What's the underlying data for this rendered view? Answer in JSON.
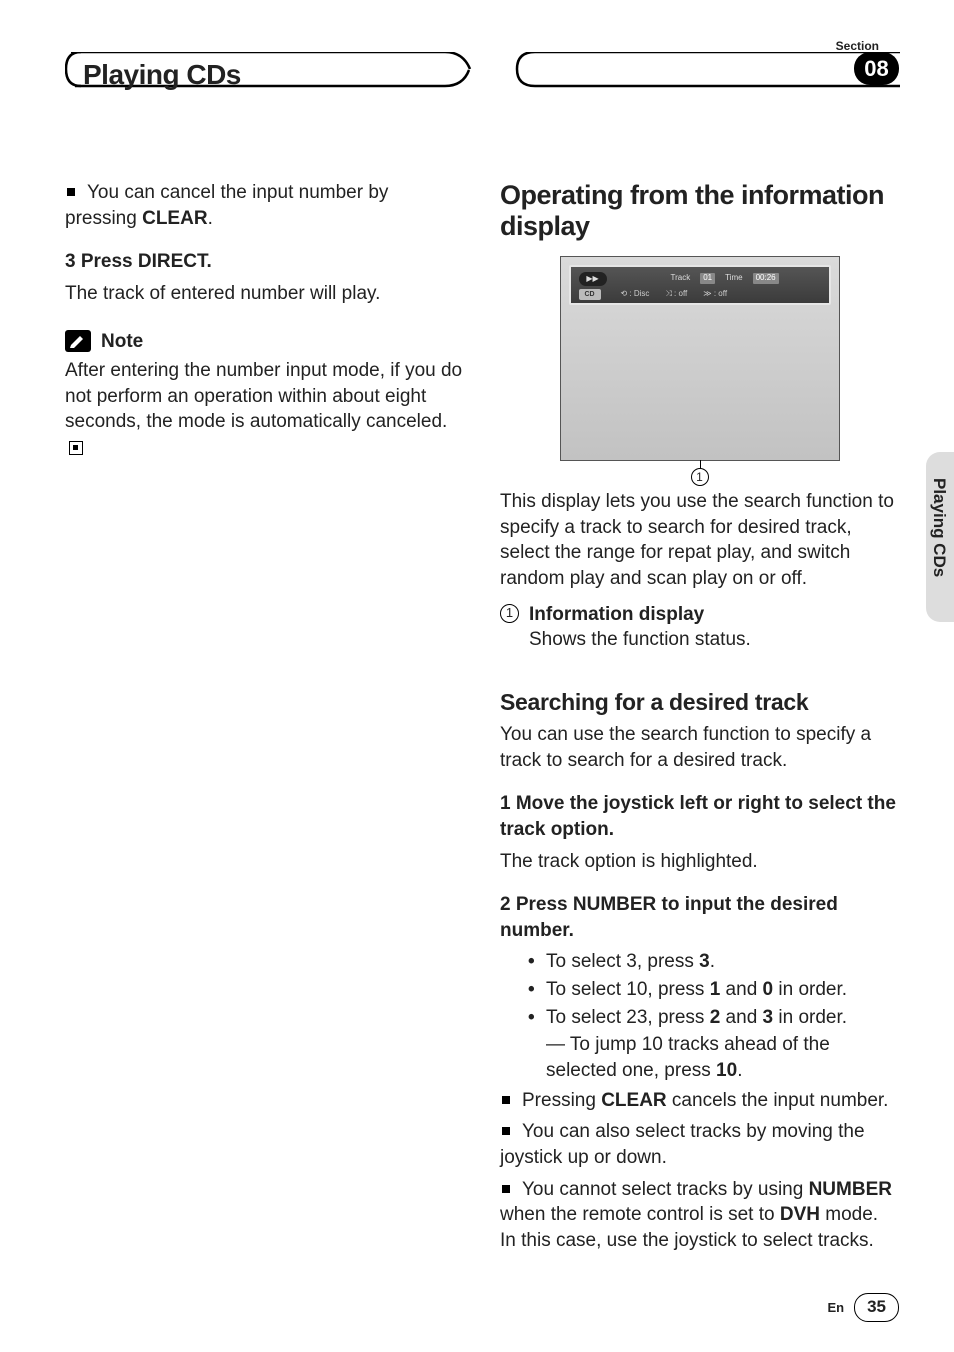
{
  "header": {
    "section_label": "Section",
    "chapter_title": "Playing CDs",
    "section_number": "08"
  },
  "side_tab": "Playing CDs",
  "left": {
    "bullet1_pre": "You can cancel the input number by pressing ",
    "bullet1_bold": "CLEAR",
    "bullet1_post": ".",
    "step3_head": "3    Press DIRECT.",
    "step3_body": "The track of entered number will play.",
    "note_label": "Note",
    "note_body": "After entering the number input mode, if you do not perform an operation within about eight seconds, the mode is automatically canceled."
  },
  "right": {
    "h1": "Operating from the information display",
    "diagram": {
      "play_icon": "▶▶",
      "cd": "CD",
      "track_label": "Track",
      "track_val": "01",
      "time_label": "Time",
      "time_val": "00:26",
      "repeat": "⟲ : Disc",
      "shuffle": "⤨ : off",
      "scan": "≫ : off",
      "callout": "1"
    },
    "intro": "This display lets you use the search function to specify a track to search for desired track, select the range for repat play, and switch random play and scan play on or off.",
    "item1_num": "1",
    "item1_label": "Information display",
    "item1_body": "Shows the function status.",
    "h2": "Searching for a desired track",
    "h2_intro": "You can use the search function to specify a track to search for a desired track.",
    "step1_head": "1    Move the joystick left or right to select the track option.",
    "step1_body": "The track option is highlighted.",
    "step2_head": "2    Press NUMBER to input the desired number.",
    "b1_a": "To select 3, press ",
    "b1_b": "3",
    "b1_c": ".",
    "b2_a": "To select 10, press ",
    "b2_b": "1",
    "b2_c": " and ",
    "b2_d": "0",
    "b2_e": " in order.",
    "b3_a": "To select 23, press ",
    "b3_b": "2",
    "b3_c": " and ",
    "b3_d": "3",
    "b3_e": " in order.",
    "b3s_a": "— To jump 10 tracks ahead of the selected one, press ",
    "b3s_b": "10",
    "b3s_c": ".",
    "sq1_a": "Pressing ",
    "sq1_b": "CLEAR",
    "sq1_c": " cancels the input number.",
    "sq2": "You can also select tracks by moving the joystick up or down.",
    "sq3_a": "You cannot select tracks by using ",
    "sq3_b": "NUMBER",
    "sq3_c": " when the remote control is set to ",
    "sq3_d": "DVH",
    "sq3_e": " mode. In this case, use the joystick to select tracks."
  },
  "footer": {
    "lang": "En",
    "page": "35"
  }
}
